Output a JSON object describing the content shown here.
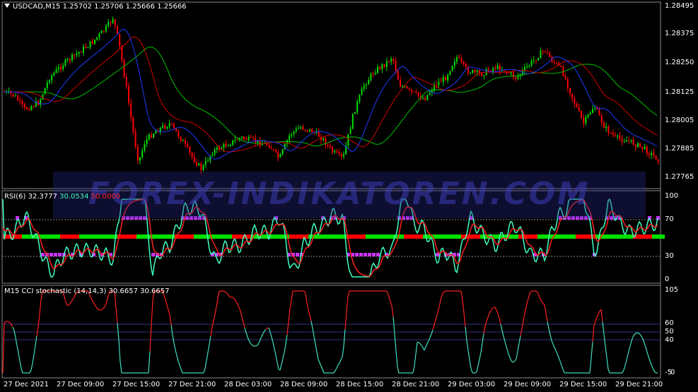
{
  "header": {
    "symbol_line": "USDCAD,M15  1.25702 1.25706 1.25666 1.25666"
  },
  "rsi_panel": {
    "title": "RSI(6) 32.3777",
    "value2": "30.0534",
    "value3": "50.0000",
    "levels": [
      "100",
      "70",
      "30",
      "0"
    ]
  },
  "cci_panel": {
    "title": "M15 CCI stochastic (14,14,3) 30.6657 30.6657",
    "levels": [
      "105",
      "60",
      "50",
      "40",
      "-5",
      "0"
    ]
  },
  "price_axis": [
    "1.28495",
    "1.28375",
    "1.28250",
    "1.28125",
    "1.28005",
    "1.27885",
    "1.27765"
  ],
  "time_axis": [
    "27 Dec 2021",
    "27 Dec 09:00",
    "27 Dec 15:00",
    "27 Dec 21:00",
    "28 Dec 03:00",
    "28 Dec 09:00",
    "28 Dec 15:00",
    "28 Dec 21:00",
    "29 Dec 03:00",
    "29 Dec 09:00",
    "29 Dec 15:00",
    "29 Dec 21:00"
  ],
  "watermark": "FOREX-INDIKATOREN.COM",
  "colors": {
    "bull": "#00e000",
    "bear": "#ff0000",
    "ma_fast": "#1e3cff",
    "ma_mid": "#d00000",
    "ma_slow": "#00c000",
    "rsi_line": "#40ffc0",
    "rsi_signal": "#ff2020",
    "rsi_dots": "#cc33ff",
    "cci_up": "#ff2020",
    "cci_down": "#40e0c0"
  }
}
